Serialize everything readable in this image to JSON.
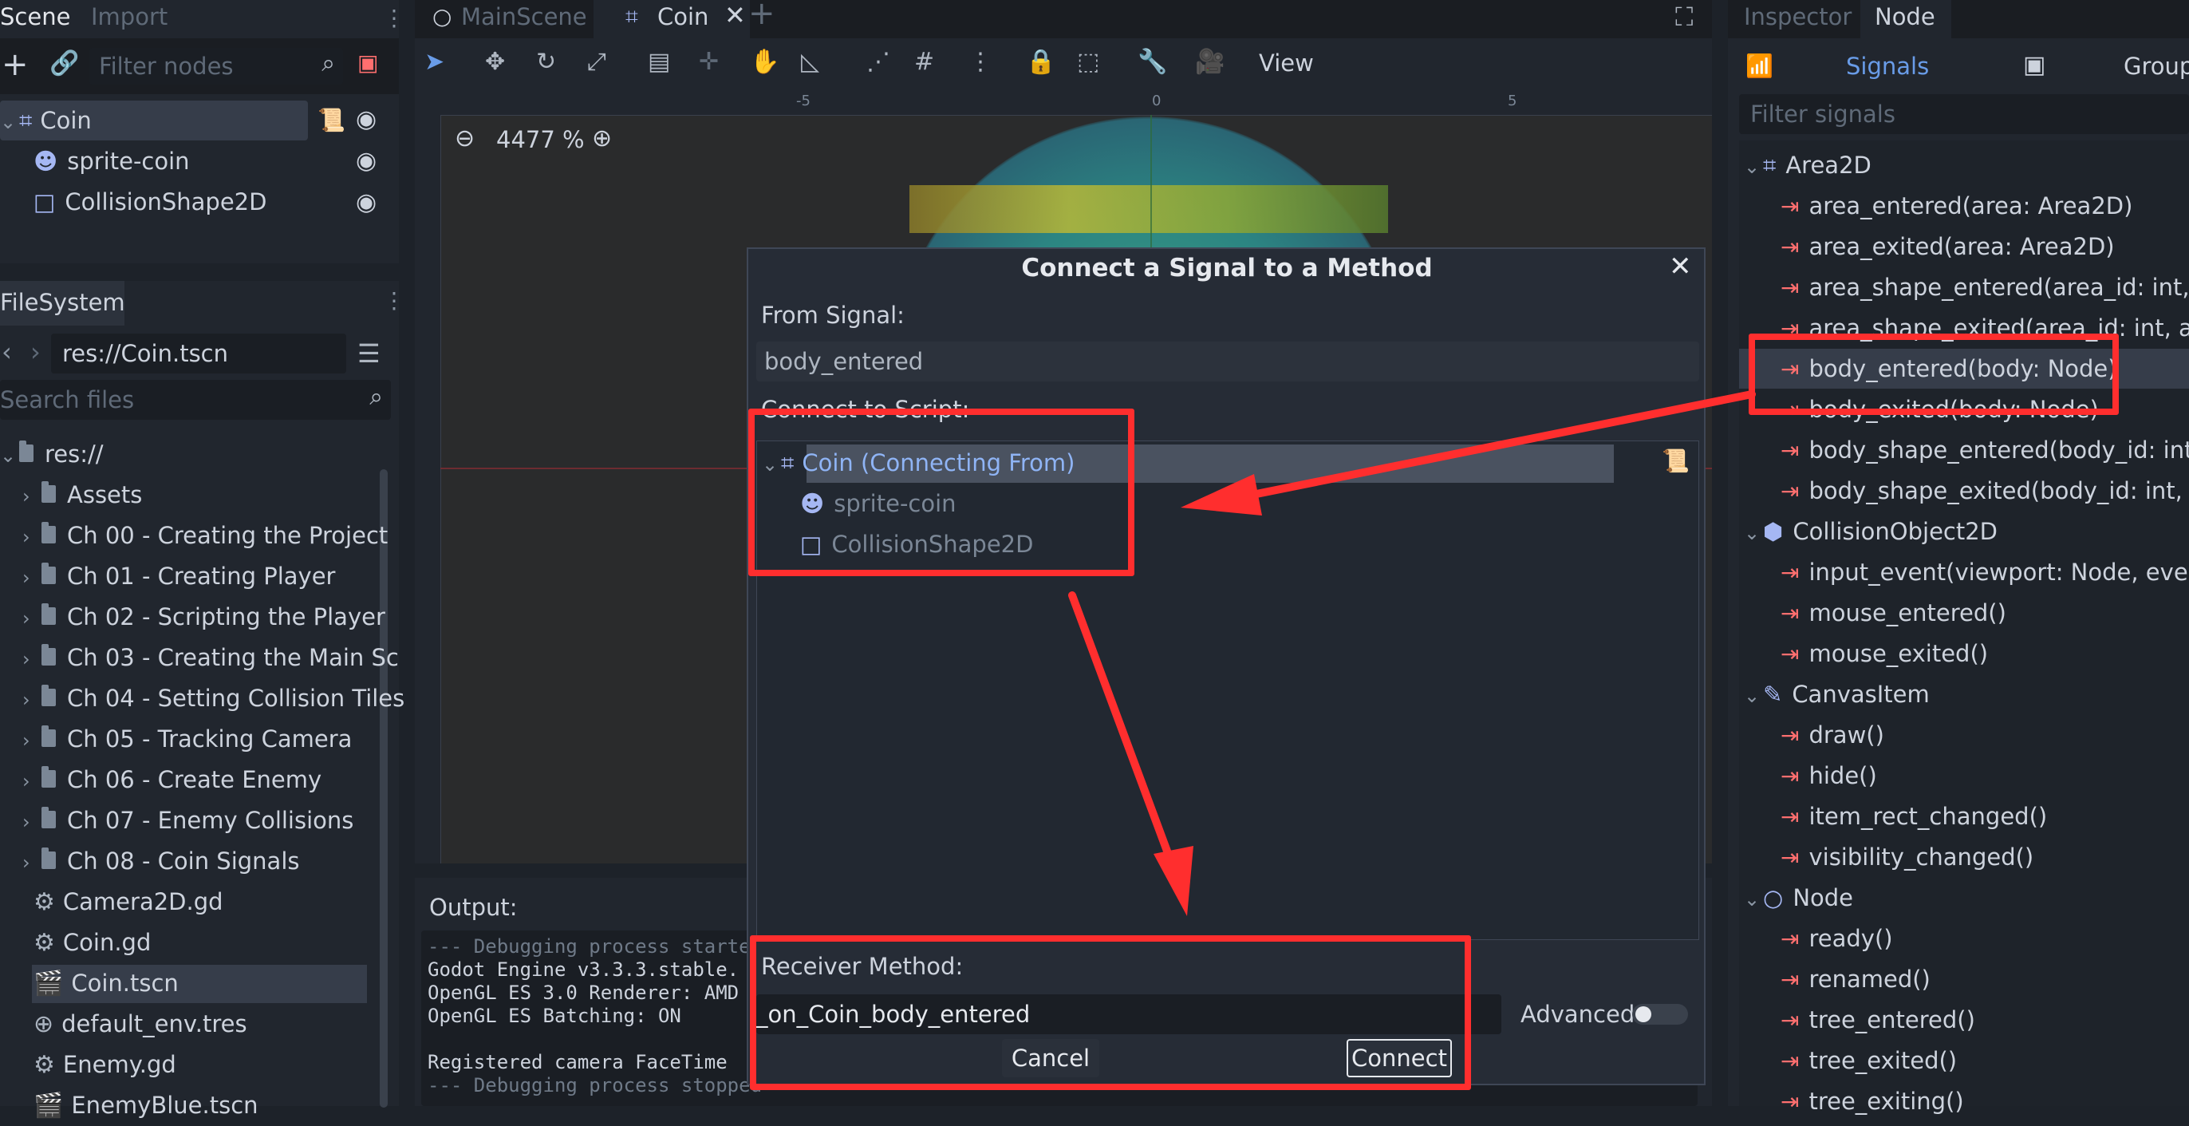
{
  "scene_dock": {
    "tabs": [
      "Scene",
      "Import"
    ],
    "filter_placeholder": "Filter nodes",
    "tree": [
      {
        "label": "Coin",
        "icon": "area2d-icon"
      },
      {
        "label": "sprite-coin",
        "icon": "sprite-icon"
      },
      {
        "label": "CollisionShape2D",
        "icon": "collisionshape-icon"
      }
    ]
  },
  "filesystem": {
    "tab": "FileSystem",
    "path": "res://Coin.tscn",
    "search_placeholder": "Search files",
    "items": [
      {
        "label": "res://",
        "type": "folder"
      },
      {
        "label": "Assets",
        "type": "folder"
      },
      {
        "label": "Ch 00 - Creating the Project",
        "type": "folder"
      },
      {
        "label": "Ch 01 - Creating Player",
        "type": "folder"
      },
      {
        "label": "Ch 02 - Scripting the Player",
        "type": "folder"
      },
      {
        "label": "Ch 03 - Creating the Main Sc",
        "type": "folder"
      },
      {
        "label": "Ch 04 - Setting Collision Tiles",
        "type": "folder"
      },
      {
        "label": "Ch 05 - Tracking Camera",
        "type": "folder"
      },
      {
        "label": "Ch 06 - Create Enemy",
        "type": "folder"
      },
      {
        "label": "Ch 07 - Enemy Collisions",
        "type": "folder"
      },
      {
        "label": "Ch 08 - Coin Signals",
        "type": "folder"
      },
      {
        "label": "Camera2D.gd",
        "type": "script"
      },
      {
        "label": "Coin.gd",
        "type": "script"
      },
      {
        "label": "Coin.tscn",
        "type": "scene"
      },
      {
        "label": "default_env.tres",
        "type": "resource"
      },
      {
        "label": "Enemy.gd",
        "type": "script"
      },
      {
        "label": "EnemyBlue.tscn",
        "type": "scene"
      }
    ]
  },
  "editor": {
    "tabs": [
      "MainScene",
      "Coin"
    ],
    "view_menu": "View",
    "zoom": "4477 %",
    "ruler_labels": [
      "-5",
      "0",
      "5"
    ],
    "output_label": "Output:",
    "output_lines": [
      "--- Debugging process started ---",
      "Godot Engine v3.3.3.stable.",
      "OpenGL ES 3.0 Renderer: AMD",
      "OpenGL ES Batching: ON",
      "",
      "Registered camera FaceTime",
      "--- Debugging process stopped ---"
    ]
  },
  "dialog": {
    "title": "Connect a Signal to a Method",
    "from_signal_label": "From Signal:",
    "from_signal_value": "body_entered",
    "connect_to_script_label": "Connect to Script:",
    "tree": [
      {
        "label": "Coin (Connecting From)",
        "icon": "area2d-icon"
      },
      {
        "label": "sprite-coin",
        "icon": "sprite-icon"
      },
      {
        "label": "CollisionShape2D",
        "icon": "collisionshape-icon"
      }
    ],
    "receiver_label": "Receiver Method:",
    "receiver_value": "_on_Coin_body_entered",
    "advanced_label": "Advanced",
    "cancel": "Cancel",
    "connect": "Connect"
  },
  "inspector": {
    "tabs": [
      "Inspector",
      "Node"
    ],
    "subtabs": [
      "Signals",
      "Groups"
    ],
    "filter_placeholder": "Filter signals",
    "groups": [
      {
        "label": "Area2D",
        "signals": [
          "area_entered(area: Area2D)",
          "area_exited(area: Area2D)",
          "area_shape_entered(area_id: int, area",
          "area_shape_exited(area_id: int, area",
          "body_entered(body: Node)",
          "body_exited(body: Node)",
          "body_shape_entered(body_id: int, bo",
          "body_shape_exited(body_id: int, bod"
        ]
      },
      {
        "label": "CollisionObject2D",
        "signals": [
          "input_event(viewport: Node, event: I",
          "mouse_entered()",
          "mouse_exited()"
        ]
      },
      {
        "label": "CanvasItem",
        "signals": [
          "draw()",
          "hide()",
          "item_rect_changed()",
          "visibility_changed()"
        ]
      },
      {
        "label": "Node",
        "signals": [
          "ready()",
          "renamed()",
          "tree_entered()",
          "tree_exited()",
          "tree_exiting()"
        ]
      }
    ]
  },
  "colors": {
    "accent": "#699ce8",
    "signal_icon": "#ff6f6f",
    "annotation_red": "#ff2e2e"
  }
}
